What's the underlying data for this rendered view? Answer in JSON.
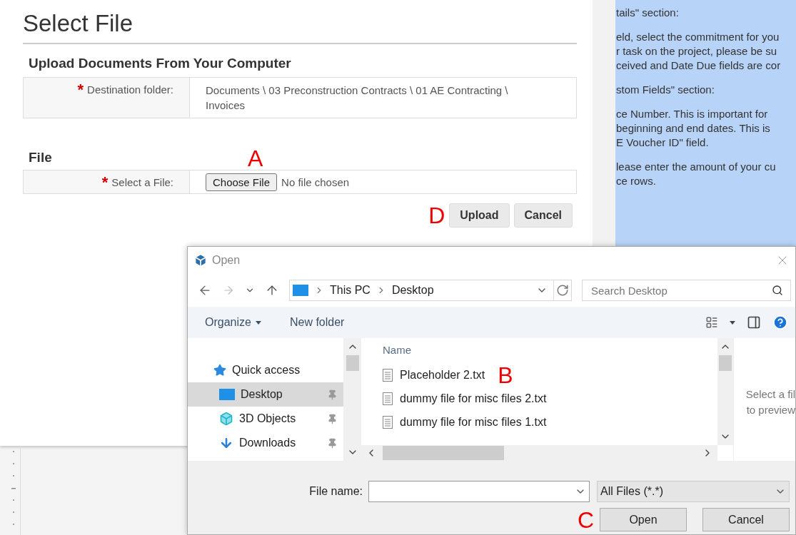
{
  "page": {
    "title": "Select File",
    "upload_heading": "Upload Documents From Your Computer",
    "destination": {
      "required_mark": "*",
      "label": "Destination folder:",
      "value": "Documents \\ 03 Preconstruction Contracts \\ 01 AE Contracting \\ Invoices"
    },
    "file_heading": "File",
    "file_annotation": "A",
    "file_field": {
      "required_mark": "*",
      "label": "Select a File:",
      "button": "Choose File",
      "status": "No file chosen"
    },
    "actions_annotation": "D",
    "buttons": [
      "Upload",
      "Cancel"
    ]
  },
  "document_panel": {
    "paragraphs": [
      [
        "tails\" section:"
      ],
      [
        "eld, select the commitment for you",
        "r task on the project, please be su",
        "ceived and Date Due fields are cor"
      ],
      [
        "stom Fields\" section:"
      ],
      [
        "ce Number. This is important for",
        "beginning and end dates. This is",
        "E Voucher ID\" field."
      ],
      [
        "lease enter the amount of your cu",
        "ce rows."
      ]
    ]
  },
  "dialog": {
    "title": "Open",
    "address": [
      "This PC",
      "Desktop"
    ],
    "search": {
      "placeholder": "Search Desktop"
    },
    "toolbar": {
      "organize": "Organize",
      "new_folder": "New folder"
    },
    "nav_items": [
      {
        "kind": "quick",
        "label": "Quick access",
        "pinned": false,
        "selected": false
      },
      {
        "kind": "desktop",
        "label": "Desktop",
        "pinned": true,
        "selected": true
      },
      {
        "kind": "objects",
        "label": "3D Objects",
        "pinned": true,
        "selected": false
      },
      {
        "kind": "downloads",
        "label": "Downloads",
        "pinned": true,
        "selected": false
      }
    ],
    "column_header": "Name",
    "file_annotation": "B",
    "files": [
      "Placeholder 2.txt",
      "dummy file for misc files 2.txt",
      "dummy file for misc files 1.txt"
    ],
    "preview": [
      "Select a fil",
      "to preview"
    ],
    "file_name": {
      "label": "File name:"
    },
    "filter": "All Files (*.*)",
    "open_annotation": "C",
    "buttons": [
      "Open",
      "Cancel"
    ]
  }
}
